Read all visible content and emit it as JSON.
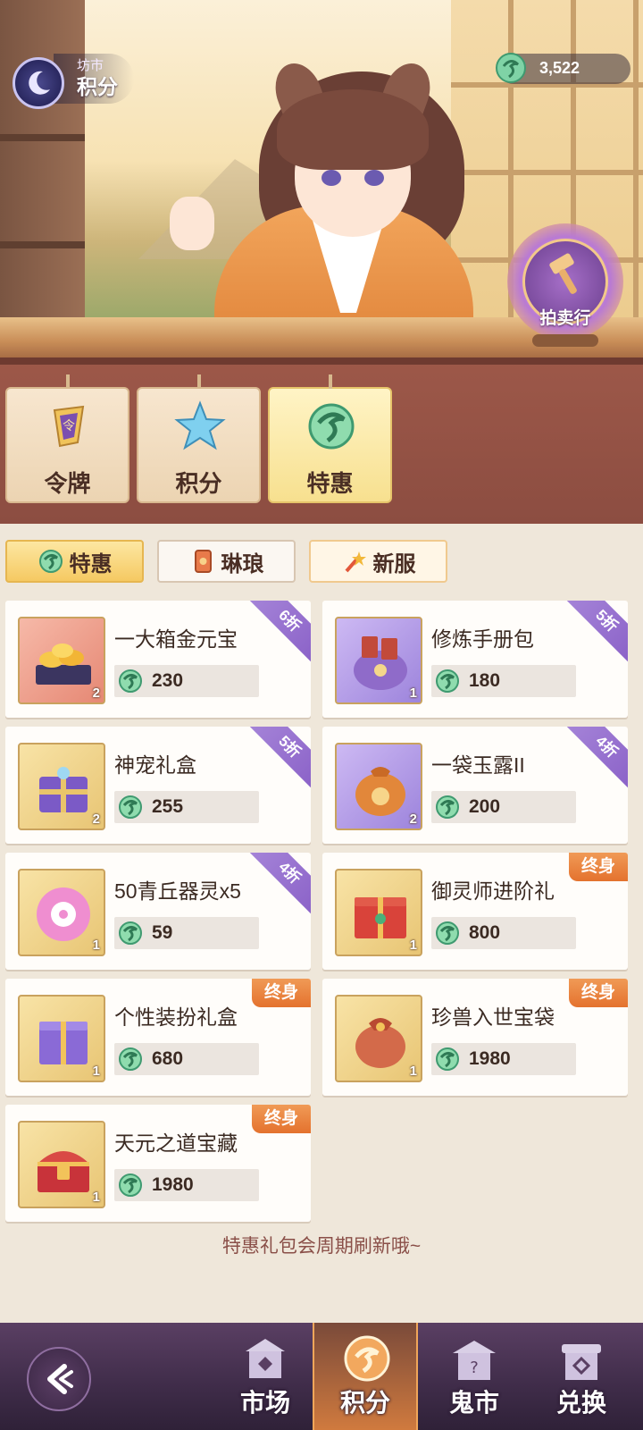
{
  "header": {
    "subtitle": "坊市",
    "title": "积分",
    "currency_value": "3,522",
    "auction_label": "拍卖行"
  },
  "categories": [
    {
      "label": "令牌",
      "icon": "token-icon",
      "active": false
    },
    {
      "label": "积分",
      "icon": "star-icon",
      "active": false
    },
    {
      "label": "特惠",
      "icon": "jade-coin-icon",
      "active": true
    }
  ],
  "subtabs": [
    {
      "label": "特惠",
      "icon": "jade-coin-icon",
      "active": true
    },
    {
      "label": "琳琅",
      "icon": "card-icon",
      "active": false
    },
    {
      "label": "新服",
      "icon": "firework-icon",
      "active": false
    }
  ],
  "items": [
    {
      "name": "一大箱金元宝",
      "price": "230",
      "qty": "2",
      "tag": "6折",
      "tag_type": "discount"
    },
    {
      "name": "修炼手册包",
      "price": "180",
      "qty": "1",
      "tag": "5折",
      "tag_type": "discount"
    },
    {
      "name": "神宠礼盒",
      "price": "255",
      "qty": "2",
      "tag": "5折",
      "tag_type": "discount"
    },
    {
      "name": "一袋玉露II",
      "price": "200",
      "qty": "2",
      "tag": "4折",
      "tag_type": "discount"
    },
    {
      "name": "50青丘器灵x5",
      "price": "59",
      "qty": "1",
      "tag": "4折",
      "tag_type": "discount"
    },
    {
      "name": "御灵师进阶礼",
      "price": "800",
      "qty": "1",
      "tag": "终身",
      "tag_type": "lifetime"
    },
    {
      "name": "个性装扮礼盒",
      "price": "680",
      "qty": "1",
      "tag": "终身",
      "tag_type": "lifetime"
    },
    {
      "name": "珍兽入世宝袋",
      "price": "1980",
      "qty": "1",
      "tag": "终身",
      "tag_type": "lifetime"
    },
    {
      "name": "天元之道宝藏",
      "price": "1980",
      "qty": "1",
      "tag": "终身",
      "tag_type": "lifetime"
    }
  ],
  "footer_note": "特惠礼包会周期刷新哦~",
  "bottom_nav": [
    {
      "label": "市场",
      "icon": "market-icon",
      "active": false
    },
    {
      "label": "积分",
      "icon": "points-icon",
      "active": true
    },
    {
      "label": "鬼市",
      "icon": "ghost-market-icon",
      "active": false
    },
    {
      "label": "兑换",
      "icon": "exchange-icon",
      "active": false
    }
  ],
  "colors": {
    "accent_gold": "#f5c962",
    "discount_ribbon": "#8b62c8",
    "lifetime_tag": "#e4722e",
    "band_brown": "#9d5849",
    "nav_bg": "#3f2c49"
  }
}
